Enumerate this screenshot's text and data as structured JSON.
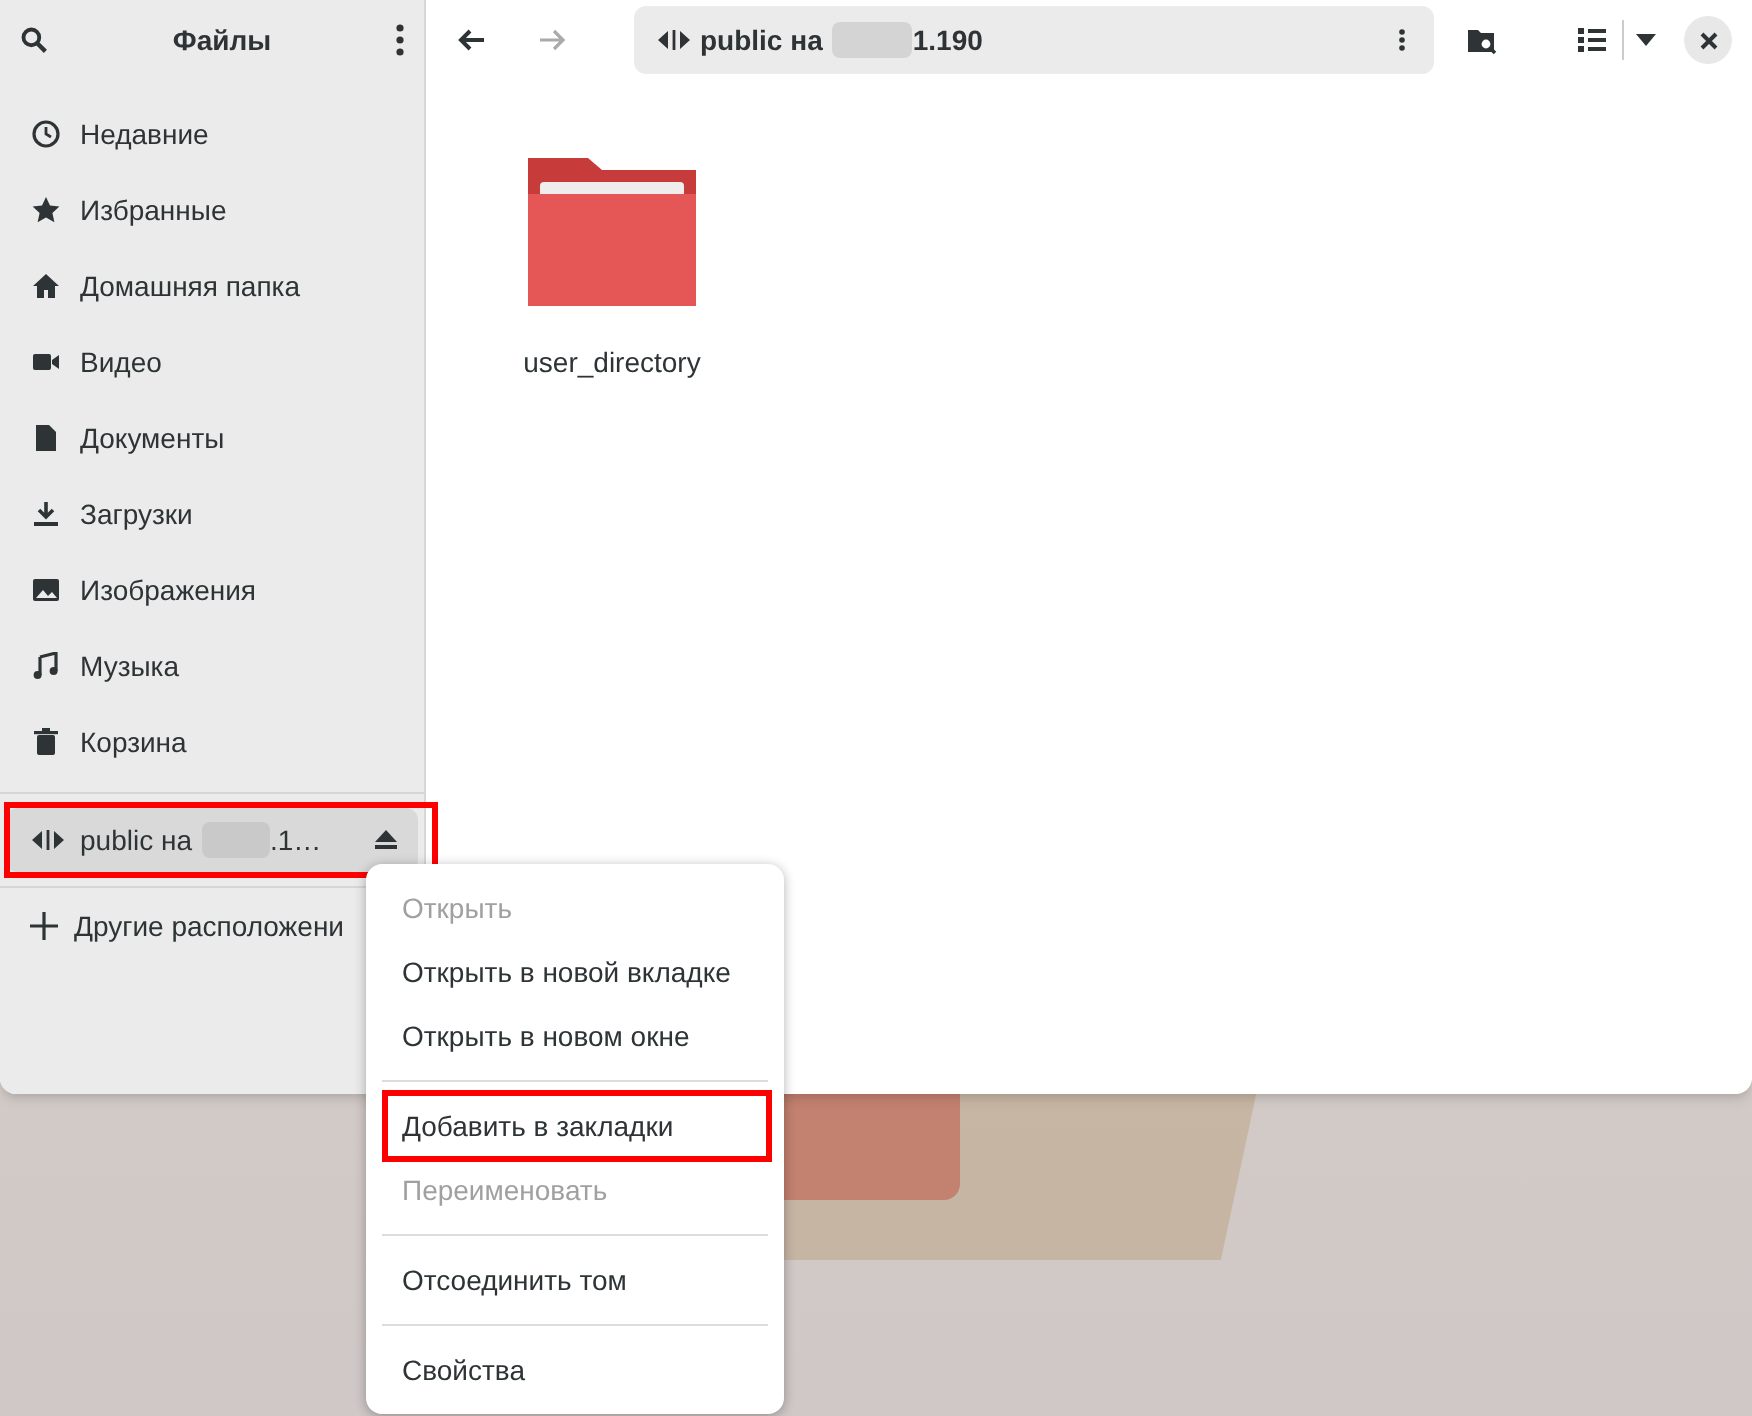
{
  "sidebar": {
    "title": "Файлы",
    "places": [
      {
        "label": "Недавние"
      },
      {
        "label": "Избранные"
      },
      {
        "label": "Домашняя папка"
      },
      {
        "label": "Видео"
      },
      {
        "label": "Документы"
      },
      {
        "label": "Загрузки"
      },
      {
        "label": "Изображения"
      },
      {
        "label": "Музыка"
      },
      {
        "label": "Корзина"
      }
    ],
    "mount": {
      "label_prefix": "public на",
      "label_suffix": ".1…",
      "highlighted": true
    },
    "other": {
      "label": "Другие расположени"
    }
  },
  "path_bar": {
    "prefix": "public на",
    "suffix": "1.190"
  },
  "files": [
    {
      "name": "user_directory"
    }
  ],
  "context_menu": [
    {
      "kind": "item",
      "label": "Открыть",
      "disabled": true,
      "highlighted": false
    },
    {
      "kind": "item",
      "label": "Открыть в новой вкладке",
      "disabled": false,
      "highlighted": false
    },
    {
      "kind": "item",
      "label": "Открыть в новом окне",
      "disabled": false,
      "highlighted": false
    },
    {
      "kind": "separator"
    },
    {
      "kind": "item",
      "label": "Добавить в закладки",
      "disabled": false,
      "highlighted": true
    },
    {
      "kind": "item",
      "label": "Переименовать",
      "disabled": true,
      "highlighted": false
    },
    {
      "kind": "separator"
    },
    {
      "kind": "item",
      "label": "Отсоединить том",
      "disabled": false,
      "highlighted": false
    },
    {
      "kind": "separator"
    },
    {
      "kind": "item",
      "label": "Свойства",
      "disabled": false,
      "highlighted": false
    }
  ]
}
